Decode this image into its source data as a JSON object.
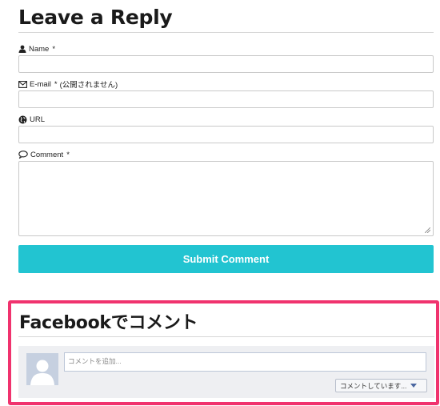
{
  "reply": {
    "title": "Leave a Reply",
    "fields": {
      "name_label": "Name",
      "email_label": "E-mail",
      "email_note": "(公開されません)",
      "url_label": "URL",
      "comment_label": "Comment",
      "required_mark": "*"
    },
    "submit_label": "Submit Comment"
  },
  "facebook": {
    "title": "Facebookでコメント",
    "comment_placeholder": "コメントを追加...",
    "post_as_label": "コメントしています..."
  },
  "colors": {
    "submit_bg": "#22c4d1",
    "highlight_border": "#f0336e"
  },
  "icons": [
    "user-icon",
    "envelope-icon",
    "globe-icon",
    "speech-bubble-icon",
    "resize-handle-icon",
    "caret-down-icon"
  ]
}
